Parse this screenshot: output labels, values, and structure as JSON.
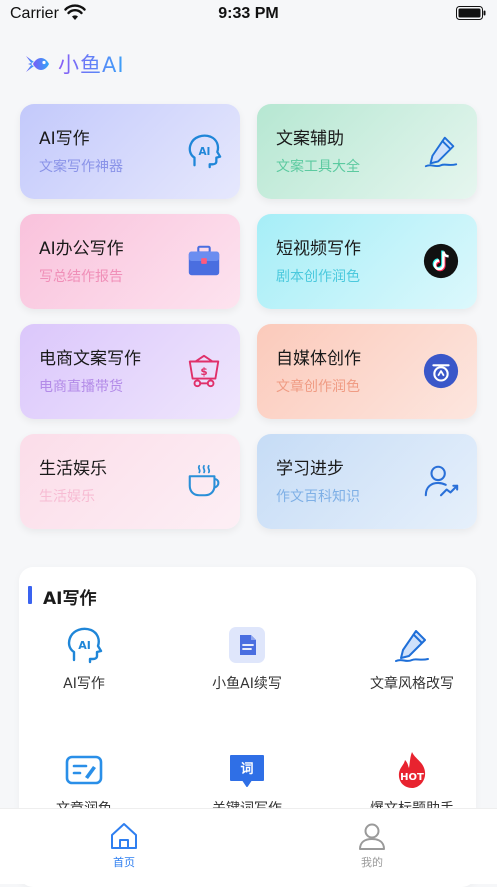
{
  "status_bar": {
    "carrier": "Carrier",
    "time": "9:33 PM"
  },
  "brand": {
    "name": "小鱼AI"
  },
  "cards": [
    {
      "title": "AI写作",
      "subtitle": "文案写作神器",
      "icon": "ai-head-icon"
    },
    {
      "title": "文案辅助",
      "subtitle": "文案工具大全",
      "icon": "pen-write-icon"
    },
    {
      "title": "AI办公写作",
      "subtitle": "写总结作报告",
      "icon": "briefcase-icon"
    },
    {
      "title": "短视频写作",
      "subtitle": "剧本创作润色",
      "icon": "tiktok-icon"
    },
    {
      "title": "电商文案写作",
      "subtitle": "电商直播带货",
      "icon": "shopping-basket-icon"
    },
    {
      "title": "自媒体创作",
      "subtitle": "文章创作润色",
      "icon": "media-badge-icon"
    },
    {
      "title": "生活娱乐",
      "subtitle": "生活娱乐",
      "icon": "coffee-cup-icon"
    },
    {
      "title": "学习进步",
      "subtitle": "作文百科知识",
      "icon": "user-growth-icon"
    }
  ],
  "section": {
    "title": "AI写作",
    "tools": [
      {
        "label": "AI写作",
        "icon": "ai-head-icon"
      },
      {
        "label": "小鱼AI续写",
        "icon": "document-icon"
      },
      {
        "label": "文章风格改写",
        "icon": "pen-write-icon"
      },
      {
        "label": "文章润色",
        "icon": "edit-box-icon"
      },
      {
        "label": "关键词写作",
        "icon": "keyword-chat-icon"
      },
      {
        "label": "爆文标题助手",
        "icon": "hot-fire-icon"
      }
    ]
  },
  "tabbar": {
    "tabs": [
      {
        "label": "首页",
        "icon": "home-icon",
        "active": true
      },
      {
        "label": "我的",
        "icon": "profile-icon",
        "active": false
      }
    ]
  },
  "colors": {
    "accent": "#3a63f0",
    "tab_active": "#2f7ff0",
    "tab_inactive": "#9a9a9a"
  }
}
